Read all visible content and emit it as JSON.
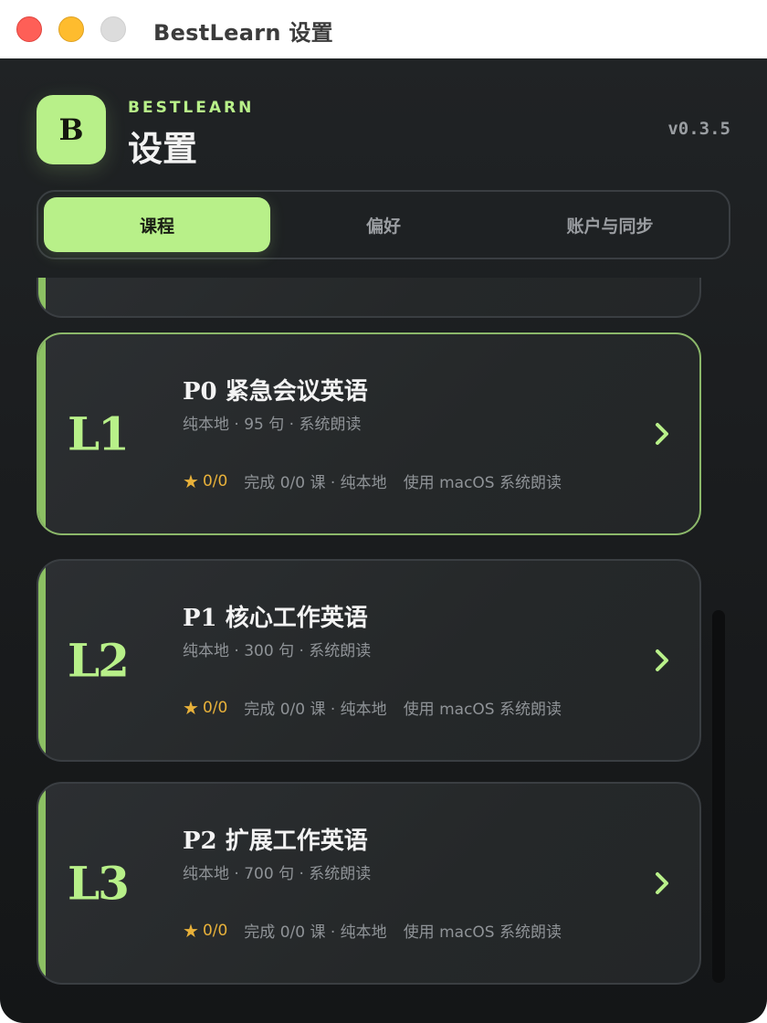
{
  "window": {
    "title": "BestLearn 设置"
  },
  "header": {
    "logo_letter": "B",
    "brand": "BESTLEARN",
    "title": "设置",
    "version": "v0.3.5"
  },
  "tabs": [
    {
      "label": "课程",
      "active": true
    },
    {
      "label": "偏好",
      "active": false
    },
    {
      "label": "账户与同步",
      "active": false
    }
  ],
  "courses": [
    {
      "level": "L1",
      "title": "P0 紧急会议英语",
      "subtitle": "纯本地 · 95 句 · 系统朗读",
      "score": "0/0",
      "progress": "完成 0/0 课 · 纯本地",
      "voice": "使用 macOS 系统朗读"
    },
    {
      "level": "L2",
      "title": "P1 核心工作英语",
      "subtitle": "纯本地 · 300 句 · 系统朗读",
      "score": "0/0",
      "progress": "完成 0/0 课 · 纯本地",
      "voice": "使用 macOS 系统朗读"
    },
    {
      "level": "L3",
      "title": "P2 扩展工作英语",
      "subtitle": "纯本地 · 700 句 · 系统朗读",
      "score": "0/0",
      "progress": "完成 0/0 课 · 纯本地",
      "voice": "使用 macOS 系统朗读"
    }
  ],
  "icons": {
    "star": "star-icon",
    "chevron": "chevron-right-icon"
  },
  "colors": {
    "accent": "#b8f089",
    "star": "#e8b13a",
    "background": "#1b1d1f"
  }
}
